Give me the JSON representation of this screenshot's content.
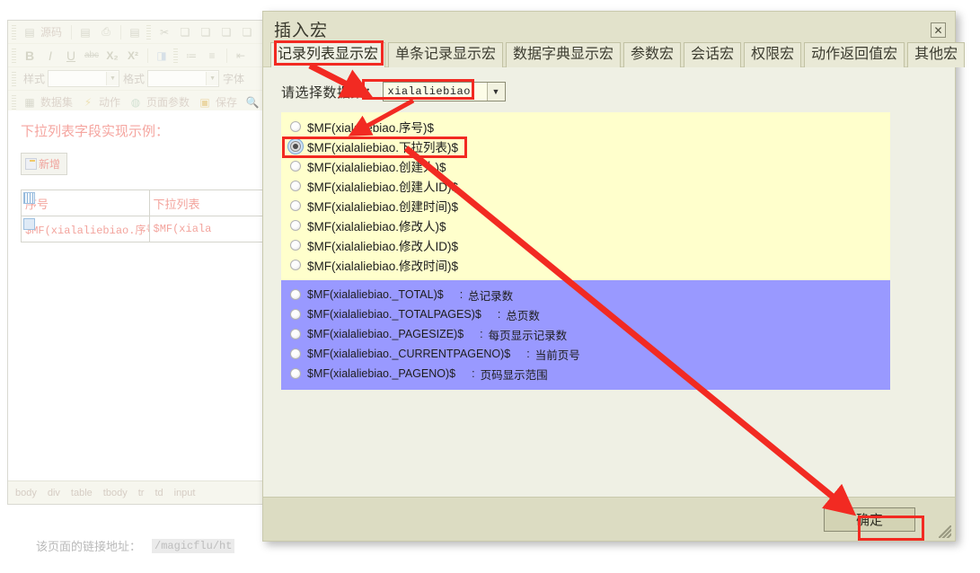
{
  "editor": {
    "toolbar": {
      "row1": [
        {
          "name": "source-icon",
          "glyph": "▤"
        },
        {
          "name": "source-label",
          "label": "源码"
        },
        {
          "name": "new-page-icon",
          "glyph": "▤"
        },
        {
          "name": "print-icon",
          "glyph": "▭"
        },
        {
          "name": "templates-icon",
          "glyph": "▤"
        },
        {
          "name": "cut-icon",
          "glyph": "✂"
        },
        {
          "name": "copy-icon",
          "glyph": "▤"
        },
        {
          "name": "paste-icon",
          "glyph": "▤"
        },
        {
          "name": "paste-text-icon",
          "glyph": "▤"
        },
        {
          "name": "paste-word-icon",
          "glyph": "▤"
        }
      ],
      "row2": [
        {
          "name": "bold-icon",
          "label": "B"
        },
        {
          "name": "italic-icon",
          "label": "I"
        },
        {
          "name": "underline-icon",
          "label": "U"
        },
        {
          "name": "strike-icon",
          "label": "abc"
        },
        {
          "name": "subscript-icon",
          "label": "X₂"
        },
        {
          "name": "superscript-icon",
          "label": "X²"
        },
        {
          "name": "remove-format-icon",
          "glyph": "◨"
        },
        {
          "name": "numbered-list-icon",
          "glyph": "≔"
        },
        {
          "name": "bulleted-list-icon",
          "glyph": "≡"
        },
        {
          "name": "outdent-icon",
          "glyph": "⇤"
        }
      ],
      "style_label": "样式",
      "format_label": "格式",
      "font_label": "字体",
      "row4": [
        {
          "name": "dataset-icon",
          "label": "数据集"
        },
        {
          "name": "action-icon",
          "label": "动作"
        },
        {
          "name": "page-params-icon",
          "label": "页面参数"
        },
        {
          "name": "save-icon",
          "label": "保存"
        },
        {
          "name": "find-icon",
          "label": ""
        }
      ]
    },
    "content": {
      "title": "下拉列表字段实现示例：",
      "add_button": "新增",
      "table": {
        "headers": [
          "序号",
          "下拉列表"
        ],
        "rows": [
          [
            "$MF(xialaliebiao.序号)$",
            "$MF(xiala"
          ]
        ]
      }
    },
    "element_path": [
      "body",
      "div",
      "table",
      "tbody",
      "tr",
      "td",
      "input"
    ],
    "page_link_label": "该页面的链接地址：",
    "page_link_value": "/magicflu/ht"
  },
  "dialog": {
    "title": "插入宏",
    "close_glyph": "✕",
    "tabs": [
      {
        "label": "记录列表显示宏",
        "active": true
      },
      {
        "label": "单条记录显示宏",
        "active": false
      },
      {
        "label": "数据字典显示宏",
        "active": false
      },
      {
        "label": "参数宏",
        "active": false
      },
      {
        "label": "会话宏",
        "active": false
      },
      {
        "label": "权限宏",
        "active": false
      },
      {
        "label": "动作返回值宏",
        "active": false
      },
      {
        "label": "其他宏",
        "active": false
      }
    ],
    "dataset_label": "请选择数据集：",
    "dataset_value": "xialaliebiao",
    "dataset_arrow": "▼",
    "field_options": [
      {
        "macro": "$MF(xialaliebiao.序号)$",
        "checked": false
      },
      {
        "macro": "$MF(xialaliebiao.下拉列表)$",
        "checked": true
      },
      {
        "macro": "$MF(xialaliebiao.创建人)$",
        "checked": false
      },
      {
        "macro": "$MF(xialaliebiao.创建人ID)$",
        "checked": false
      },
      {
        "macro": "$MF(xialaliebiao.创建时间)$",
        "checked": false
      },
      {
        "macro": "$MF(xialaliebiao.修改人)$",
        "checked": false
      },
      {
        "macro": "$MF(xialaliebiao.修改人ID)$",
        "checked": false
      },
      {
        "macro": "$MF(xialaliebiao.修改时间)$",
        "checked": false
      }
    ],
    "system_options": [
      {
        "macro": "$MF(xialaliebiao._TOTAL)$",
        "colon": ":",
        "desc": "总记录数",
        "checked": false
      },
      {
        "macro": "$MF(xialaliebiao._TOTALPAGES)$",
        "colon": ":",
        "desc": "总页数",
        "checked": false
      },
      {
        "macro": "$MF(xialaliebiao._PAGESIZE)$",
        "colon": ":",
        "desc": "每页显示记录数",
        "checked": false
      },
      {
        "macro": "$MF(xialaliebiao._CURRENTPAGENO)$",
        "colon": ":",
        "desc": "当前页号",
        "checked": false
      },
      {
        "macro": "$MF(xialaliebiao._PAGENO)$",
        "colon": ":",
        "desc": "页码显示范围",
        "checked": false
      }
    ],
    "ok_button": "确定"
  },
  "colors": {
    "field_list_bg": "#FFFFCC",
    "system_list_bg": "#9999FF",
    "dialog_bg": "#EFF0E4",
    "dialog_header": "#E2E2CB",
    "annotation_red": "#F22A22"
  }
}
